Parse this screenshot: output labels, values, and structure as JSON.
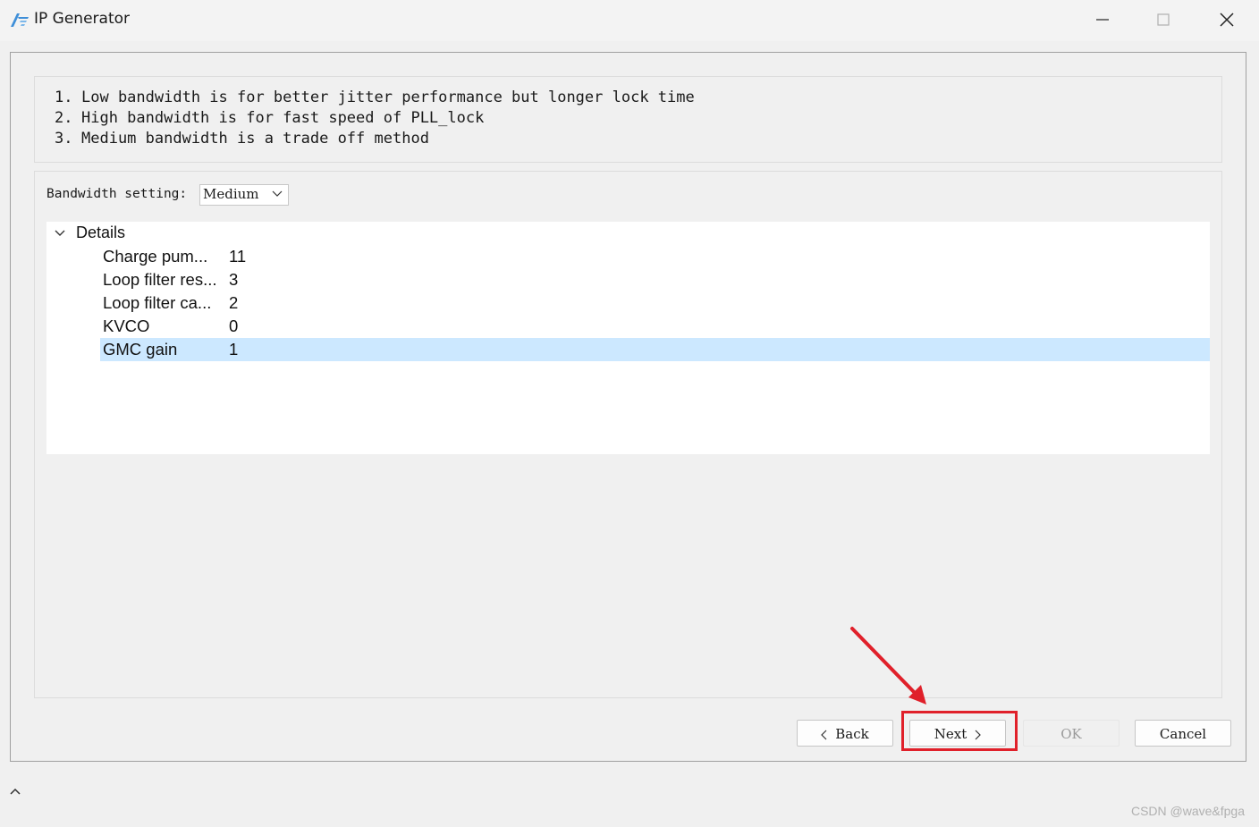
{
  "window": {
    "title": "IP Generator",
    "minimize_icon": "minimize-icon",
    "maximize_icon": "maximize-icon",
    "close_icon": "close-icon"
  },
  "info": {
    "items": [
      {
        "num": "1.",
        "text": "Low bandwidth is for better jitter performance but longer lock time"
      },
      {
        "num": "2.",
        "text": "High bandwidth is for fast speed of PLL_lock"
      },
      {
        "num": "3.",
        "text": "Medium bandwidth is a trade off method"
      }
    ]
  },
  "settings": {
    "bandwidth_label": "Bandwidth setting:",
    "bandwidth_value": "Medium"
  },
  "details": {
    "header": "Details",
    "rows": [
      {
        "name": "Charge pum...",
        "value": "11"
      },
      {
        "name": "Loop filter res...",
        "value": "3"
      },
      {
        "name": "Loop filter ca...",
        "value": "2"
      },
      {
        "name": "KVCO",
        "value": "0"
      },
      {
        "name": "GMC gain",
        "value": "1",
        "selected": true
      }
    ]
  },
  "buttons": {
    "back": "Back",
    "next": "Next",
    "ok": "OK",
    "cancel": "Cancel"
  },
  "watermark": "CSDN @wave&fpga",
  "colors": {
    "selection": "#cce8ff",
    "annotation": "#e0202a",
    "logo": "#3f8fd8"
  }
}
